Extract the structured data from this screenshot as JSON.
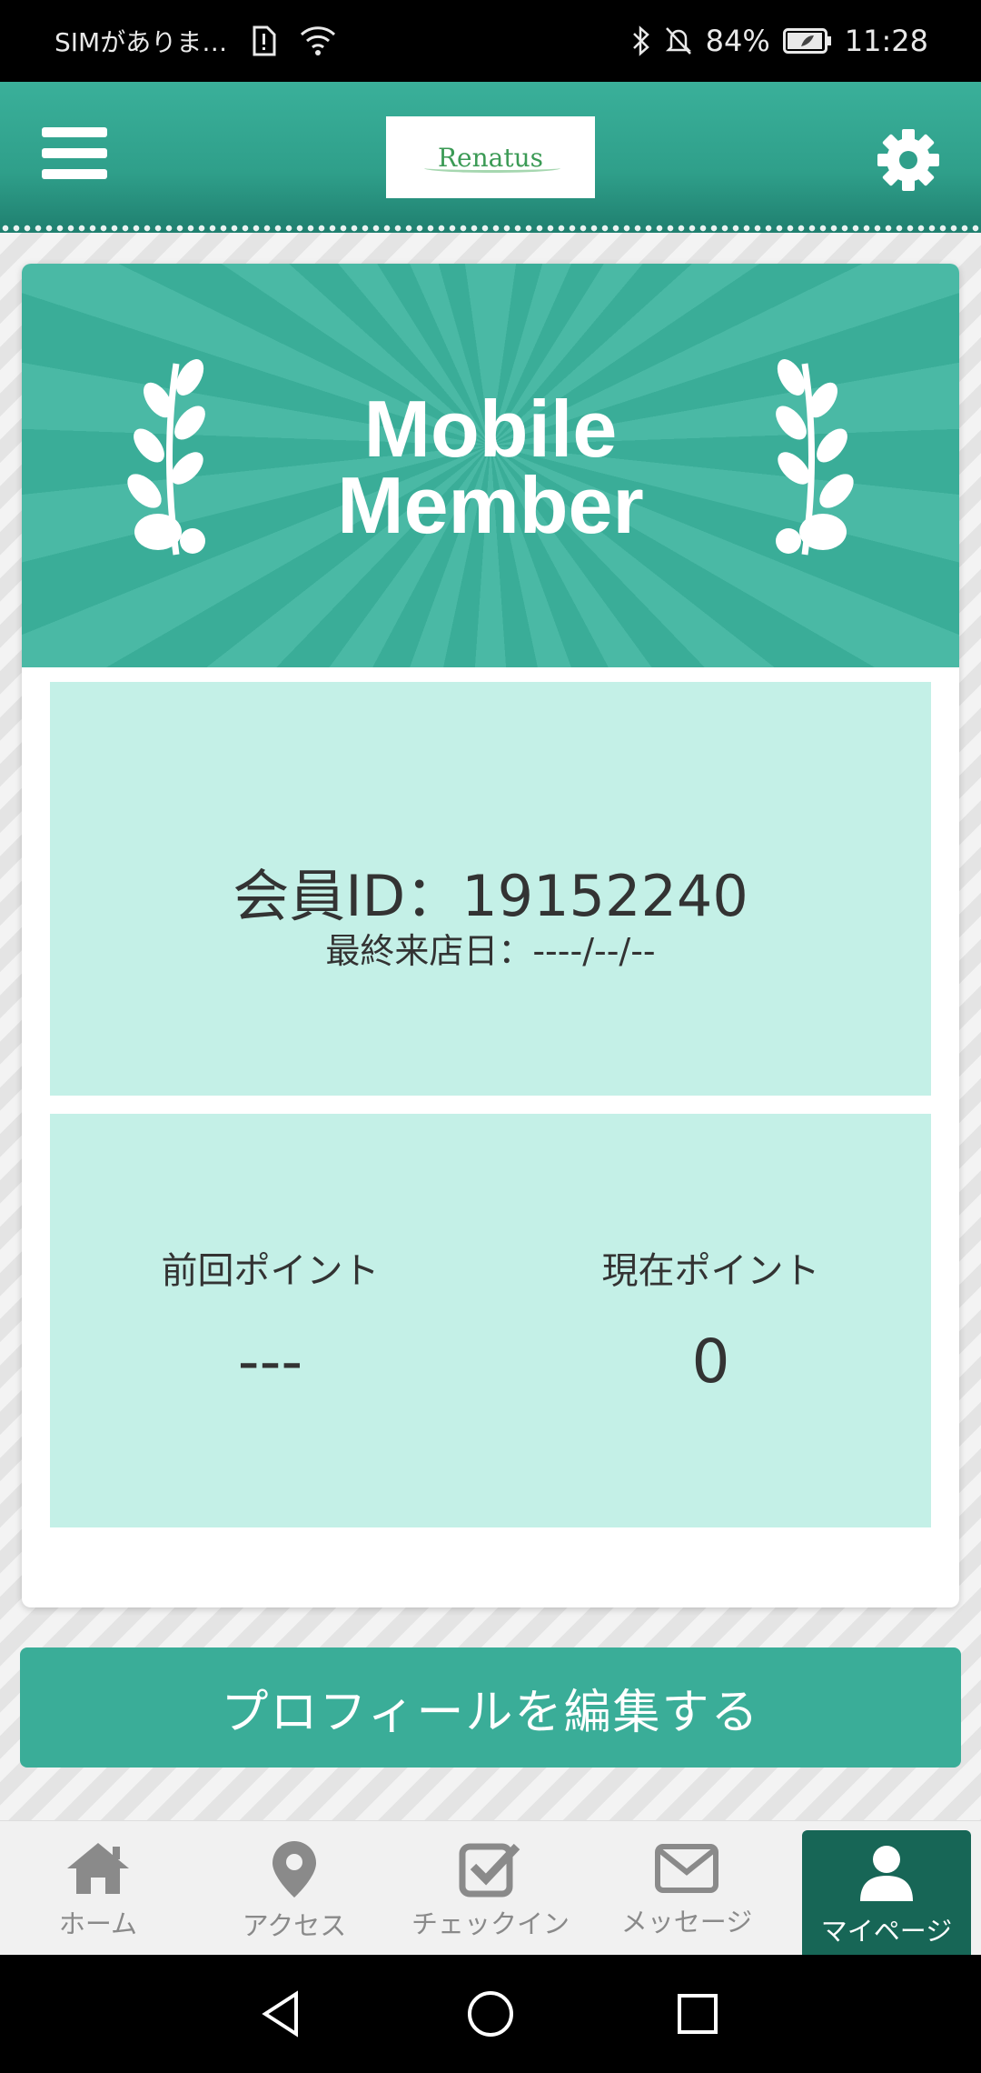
{
  "status_bar": {
    "carrier": "SIMがありま…",
    "battery": "84%",
    "time": "11:28"
  },
  "header": {
    "logo_text": "Renatus",
    "menu_icon": "hamburger-icon",
    "settings_icon": "gear-icon"
  },
  "card": {
    "banner_title_line1": "Mobile",
    "banner_title_line2": "Member",
    "member_id": "会員ID：19152240",
    "last_visit": "最終来店日：----/--/--",
    "previous_points_label": "前回ポイント",
    "previous_points_value": "---",
    "current_points_label": "現在ポイント",
    "current_points_value": "0"
  },
  "edit_profile_label": "プロフィールを編集する",
  "tabs": [
    {
      "label": "ホーム",
      "icon": "home-icon"
    },
    {
      "label": "アクセス",
      "icon": "map-pin-icon"
    },
    {
      "label": "チェックイン",
      "icon": "checkbox-icon"
    },
    {
      "label": "メッセージ",
      "icon": "envelope-icon"
    },
    {
      "label": "マイページ",
      "icon": "user-icon",
      "active": true
    }
  ],
  "colors": {
    "primary": "#3aad98",
    "header_dark": "#1f7f6f",
    "panel": "#c4f0e7",
    "active_tab": "#176656"
  }
}
